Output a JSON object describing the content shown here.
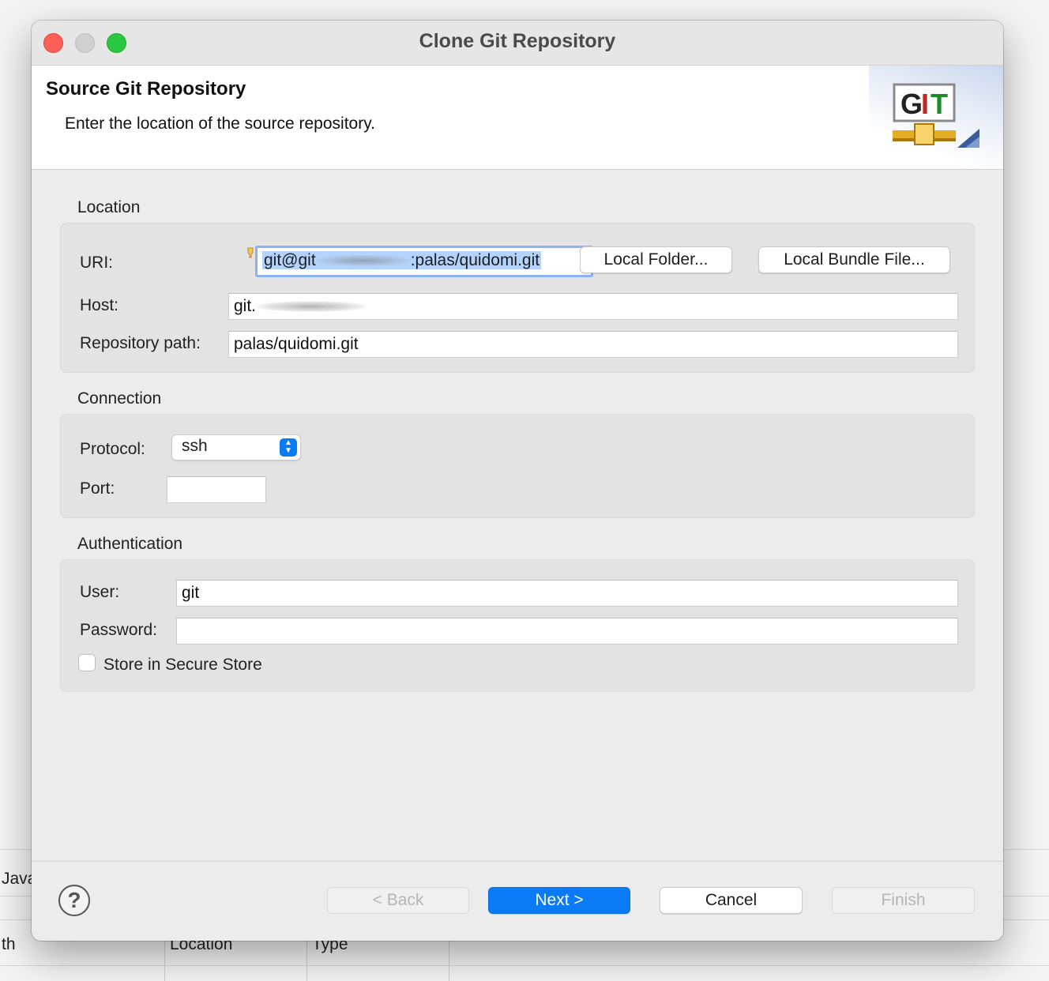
{
  "background": {
    "java_label": "Java",
    "col_path": "th",
    "col_location": "Location",
    "col_type": "Type"
  },
  "window": {
    "title": "Clone Git Repository",
    "banner_title": "Source Git Repository",
    "banner_description": "Enter the location of the source repository.",
    "logo_text": "GIT"
  },
  "location": {
    "group_label": "Location",
    "uri_label": "URI:",
    "uri_value_prefix": "git@git",
    "uri_value_suffix": ":palas/quidomi.git",
    "local_folder_button": "Local Folder...",
    "local_bundle_button": "Local Bundle File...",
    "host_label": "Host:",
    "host_value": "git.",
    "repo_path_label": "Repository path:",
    "repo_path_value": "palas/quidomi.git"
  },
  "connection": {
    "group_label": "Connection",
    "protocol_label": "Protocol:",
    "protocol_value": "ssh",
    "port_label": "Port:",
    "port_value": ""
  },
  "authentication": {
    "group_label": "Authentication",
    "user_label": "User:",
    "user_value": "git",
    "password_label": "Password:",
    "password_value": "",
    "store_label": "Store in Secure Store",
    "store_checked": false
  },
  "footer": {
    "help_icon": "?",
    "back_button": "< Back",
    "next_button": "Next >",
    "cancel_button": "Cancel",
    "finish_button": "Finish"
  },
  "colors": {
    "accent": "#0a7bf5",
    "focus_ring": "#8bb2f5",
    "selection": "#b3d3fd",
    "close": "#fe5f57",
    "maximize": "#28c840"
  }
}
